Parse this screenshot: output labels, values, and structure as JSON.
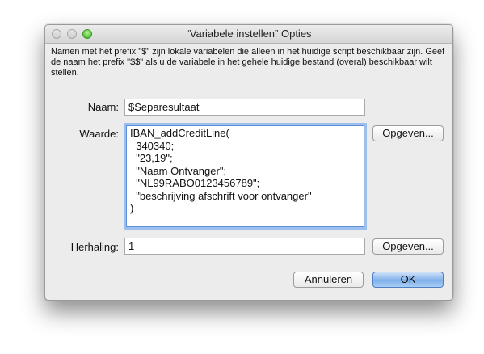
{
  "window": {
    "title": "“Variabele instellen” Opties"
  },
  "intro_text": "Namen met het prefix \"$\" zijn lokale variabelen die alleen in het huidige script beschikbaar zijn. Geef de naam het prefix \"$$\" als u de variabele in het gehele huidige bestand (overal) beschikbaar wilt stellen.",
  "fields": {
    "naam": {
      "label": "Naam:",
      "value": "$Separesultaat"
    },
    "waarde": {
      "label": "Waarde:",
      "lines": [
        "IBAN_addCreditLine(",
        "  340340;",
        "  \"23,19\";",
        "  \"Naam Ontvanger\";",
        "  \"NL99RABO0123456789\";",
        "  \"beschrijving afschrift voor ontvanger\"",
        ")"
      ]
    },
    "herhaling": {
      "label": "Herhaling:",
      "value": "1"
    }
  },
  "buttons": {
    "opgeven": "Opgeven...",
    "annuleren": "Annuleren",
    "ok": "OK"
  }
}
